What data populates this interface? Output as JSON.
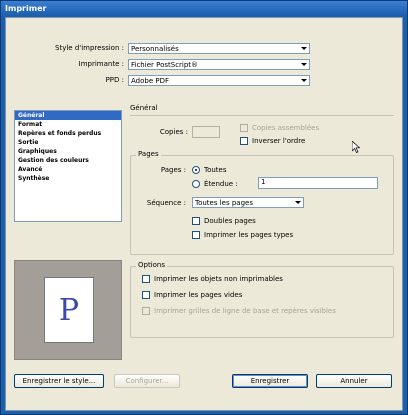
{
  "window": {
    "title": "Imprimer"
  },
  "style": {
    "label": "Style d'impression :",
    "value": "Personnalisés"
  },
  "printer": {
    "label": "Imprimante :",
    "value": "Fichier PostScript®"
  },
  "ppd": {
    "label": "PPD :",
    "value": "Adobe PDF"
  },
  "sidebar": {
    "items": [
      {
        "label": "Général",
        "selected": true
      },
      {
        "label": "Format"
      },
      {
        "label": "Repères et fonds perdus"
      },
      {
        "label": "Sortie"
      },
      {
        "label": "Graphiques"
      },
      {
        "label": "Gestion des couleurs"
      },
      {
        "label": "Avancé"
      },
      {
        "label": "Synthèse"
      }
    ]
  },
  "preview": {
    "letter": "P"
  },
  "general": {
    "heading": "Général",
    "copies_label": "Copies :",
    "copies_value": "",
    "collate": "Copies assemblées",
    "reverse": "Inverser l'ordre"
  },
  "pages": {
    "heading": "Pages",
    "pages_label": "Pages :",
    "all": "Toutes",
    "range": "Étendue :",
    "range_value": "1",
    "sequence_label": "Séquence :",
    "sequence_value": "Toutes les pages",
    "spreads": "Doubles pages",
    "master_pages": "Imprimer les pages types"
  },
  "options": {
    "heading": "Options",
    "nonprinting": "Imprimer les objets non imprimables",
    "blank_pages": "Imprimer les pages vides",
    "grids": "Imprimer grilles de ligne de base et repères visibles"
  },
  "buttons": {
    "save_style": "Enregistrer le style...",
    "setup": "Configurer...",
    "save": "Enregistrer",
    "cancel": "Annuler"
  }
}
